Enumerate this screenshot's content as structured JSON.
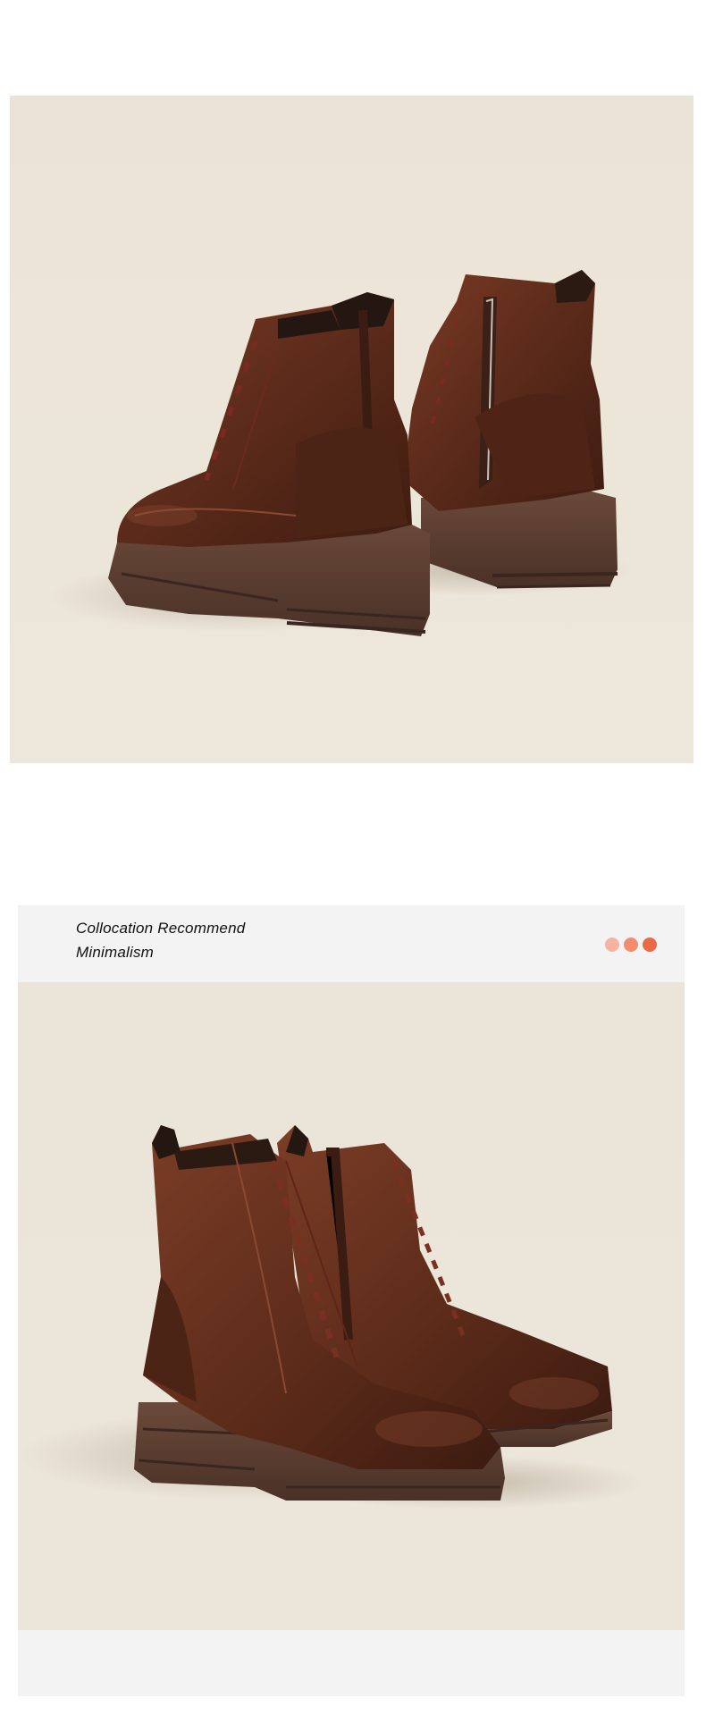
{
  "header": {
    "line1": "Collocation Recommend",
    "line2": "Minimalism"
  },
  "dots": {
    "colors": [
      "#f5b3a0",
      "#f08e6f",
      "#ea6a45"
    ]
  },
  "photos": {
    "top_icon": "brown-lace-up-boots-back-view-icon",
    "bottom_icon": "brown-lace-up-boots-front-view-icon"
  },
  "colors": {
    "backdrop": "#ebe5d9",
    "leather": "#5b2a1a",
    "sole": "#5d4032",
    "band": "#f3f3f3"
  }
}
